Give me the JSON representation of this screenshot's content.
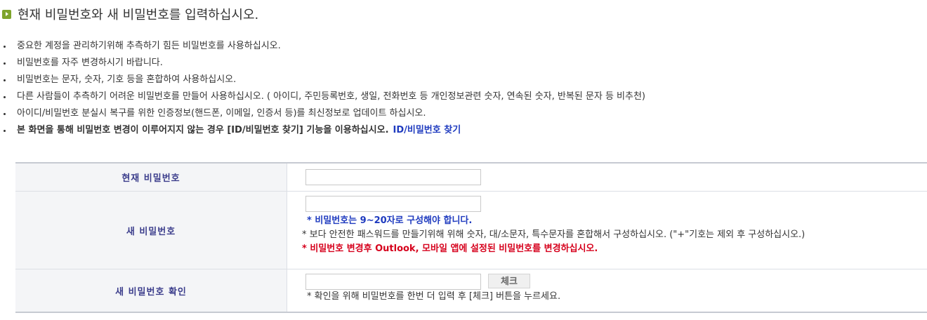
{
  "header": {
    "title": "현재 비밀번호와 새 비밀번호를 입력하십시오."
  },
  "guide": {
    "items": [
      "중요한 계정을 관리하기위해 추측하기 힘든 비밀번호를 사용하십시오.",
      "비밀번호를 자주 변경하시기 바랍니다.",
      "비밀번호는 문자, 숫자, 기호 등을 혼합하여 사용하십시오.",
      "다른 사람들이 추측하기 어려운 비밀번호를 만들어 사용하십시오. ( 아이디, 주민등록번호, 생일, 전화번호 등 개인정보관련 숫자, 연속된 숫자, 반복된 문자 등 비추천)",
      "아이디/비밀번호 분실시 복구를 위한 인증정보(핸드폰, 이메일, 인증서 등)를 최신정보로 업데이트 하십시오."
    ],
    "bold_item": "본 화면을 통해 비밀번호 변경이 이루어지지 않는 경우 [ID/비밀번호 찾기] 기능을 이용하십시오.",
    "link_label": "ID/비밀번호 찾기"
  },
  "form": {
    "current_password": {
      "label": "현재 비밀번호",
      "value": ""
    },
    "new_password": {
      "label": "새 비밀번호",
      "value": "",
      "note_length": "* 비밀번호는 9~20자로 구성해야 합니다.",
      "note_safe": "* 보다 안전한 패스워드를 만들기위해 위해 숫자, 대/소문자, 특수문자를 혼합해서 구성하십시오. (\"+\"기호는 제외 후 구성하십시오.)",
      "note_warning": "* 비밀번호 변경후 Outlook, 모바일 앱에 설정된 비밀번호를 변경하십시오."
    },
    "confirm_password": {
      "label": "새 비밀번호 확인",
      "value": "",
      "check_button": "체크",
      "note": "* 확인을 위해 비밀번호를 한번 더 입력 후 [체크] 버튼을 누르세요."
    }
  }
}
